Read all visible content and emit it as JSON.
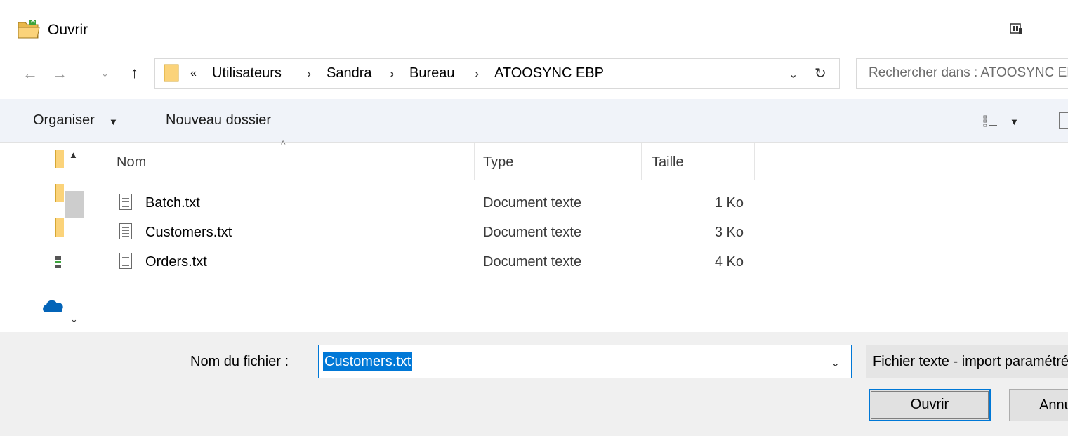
{
  "window": {
    "title": "Ouvrir"
  },
  "navigation": {
    "back_icon": "back-arrow-icon",
    "forward_icon": "forward-arrow-icon",
    "recent_icon": "chevron-down-icon",
    "up_icon": "up-arrow-icon",
    "address": {
      "overflow": "«",
      "crumbs": [
        "Utilisateurs",
        "Sandra",
        "Bureau",
        "ATOOSYNC EBP"
      ],
      "separator": "›"
    },
    "search_placeholder": "Rechercher dans : ATOOSYNC EBP"
  },
  "toolbar": {
    "organize_label": "Organiser",
    "new_folder_label": "Nouveau dossier"
  },
  "file_list": {
    "columns": [
      "Nom",
      "Type",
      "Taille"
    ],
    "rows": [
      {
        "name": "Batch.txt",
        "type": "Document texte",
        "size": "1 Ko"
      },
      {
        "name": "Customers.txt",
        "type": "Document texte",
        "size": "3 Ko"
      },
      {
        "name": "Orders.txt",
        "type": "Document texte",
        "size": "4 Ko"
      }
    ]
  },
  "footer": {
    "filename_label": "Nom du fichier :",
    "filename_value": "Customers.txt",
    "filter_value": "Fichier texte - import paramétré",
    "open_label": "Ouvrir",
    "cancel_label": "Annuler"
  },
  "colors": {
    "accent": "#0078d7",
    "toolbar_bg": "#f0f3f9",
    "footer_bg": "#f0f0f0",
    "folder_yellow": "#fbd37a"
  }
}
